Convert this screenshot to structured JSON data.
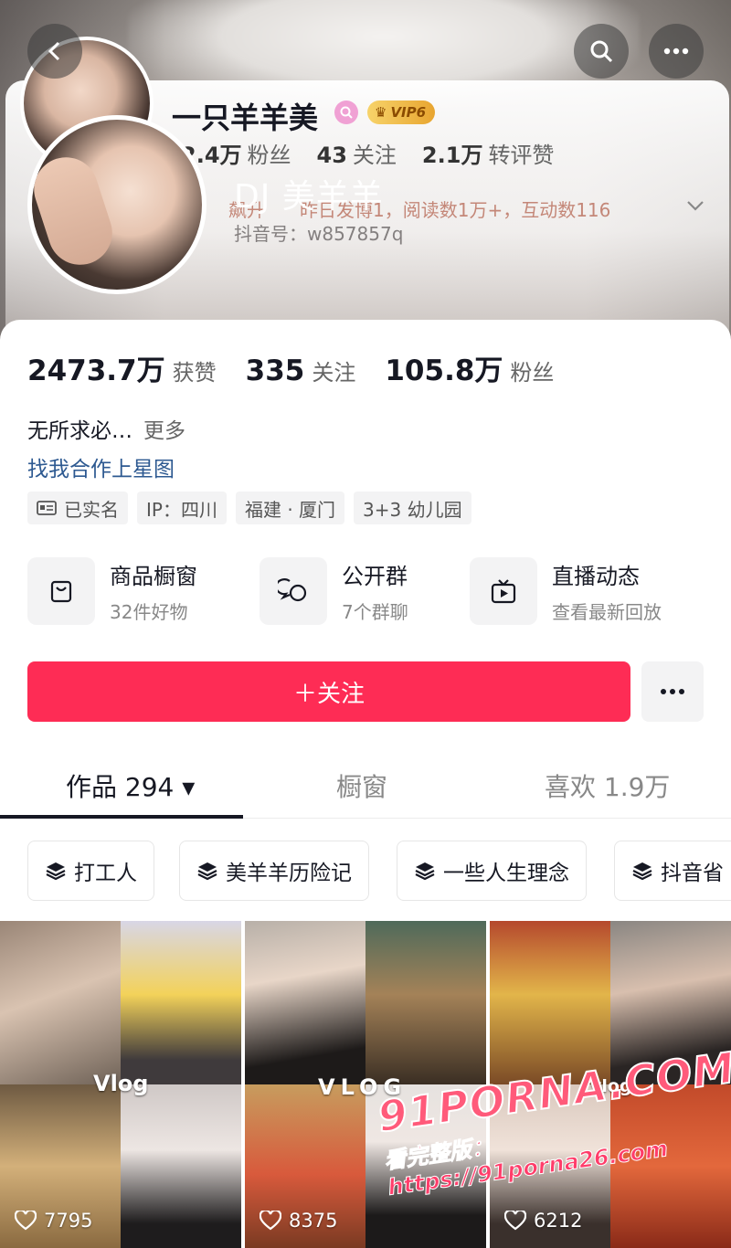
{
  "banner": {
    "old_name": "一只羊羊美",
    "vip_label": "VIP6",
    "old_stats": [
      {
        "num": "2.4万",
        "label": "粉丝"
      },
      {
        "num": "43",
        "label": "关注"
      },
      {
        "num": "2.1万",
        "label": "转评赞"
      }
    ],
    "overlay_name": "DJ 美羊羊",
    "activity_left": "飙升",
    "activity_text": "昨日发博1，阅读数1万+，互动数116",
    "douyin_id": "抖音号：w857857q"
  },
  "stats": [
    {
      "num": "2473.7万",
      "label": "获赞"
    },
    {
      "num": "335",
      "label": "关注"
    },
    {
      "num": "105.8万",
      "label": "粉丝"
    }
  ],
  "bio": {
    "text": "无所求必…",
    "more": "更多"
  },
  "cooperation_link": "找我合作上星图",
  "tags": [
    "已实名",
    "IP：四川",
    "福建 · 厦门",
    "3+3 幼儿园"
  ],
  "services": [
    {
      "title": "商品橱窗",
      "sub": "32件好物",
      "icon": "bag-icon"
    },
    {
      "title": "公开群",
      "sub": "7个群聊",
      "icon": "chat-bubbles-icon"
    },
    {
      "title": "直播动态",
      "sub": "查看最新回放",
      "icon": "tv-icon"
    }
  ],
  "follow_label": "＋关注",
  "tabs": [
    {
      "label": "作品 294 ▾",
      "active": true
    },
    {
      "label": "橱窗",
      "active": false
    },
    {
      "label": "喜欢 1.9万",
      "active": false
    }
  ],
  "collections": [
    "打工人",
    "美羊羊历险记",
    "一些人生理念",
    "抖音省"
  ],
  "videos": [
    {
      "likes": "7795",
      "label": "Vlog"
    },
    {
      "likes": "8375",
      "label": "VLOG"
    },
    {
      "likes": "6212",
      "label": "vlog"
    }
  ],
  "watermark": {
    "line1": "91PORNA.COM",
    "line2": "看完整版：https://91porna26.com"
  },
  "colors": {
    "primary": "#fe2c55",
    "link": "#2d5991",
    "text": "#161823",
    "chip_bg": "#f3f3f4"
  }
}
